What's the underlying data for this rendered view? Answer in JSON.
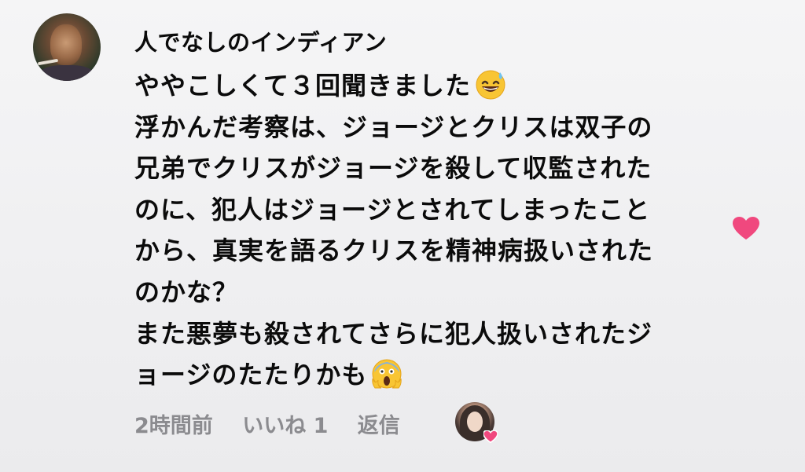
{
  "comment": {
    "username": "人でなしのインディアン",
    "lines": [
      "ややこしくて３回聞きました",
      "浮かんだ考察は、ジョージとクリスは双子の",
      "兄弟でクリスがジョージを殺して収監された",
      "のに、犯人はジョージとされてしまったこと",
      "から、真実を語るクリスを精神病扱いされた",
      "のかな？",
      "また悪夢も殺されてさらに犯人扱いされたジ",
      "ョージのたたりかも"
    ],
    "emoji_line1": "grinning-face-with-sweat",
    "emoji_line8": "face-screaming-in-fear",
    "time": "2時間前",
    "likes": "いいね 1",
    "reply": "返信",
    "like_color": "#f0487e"
  }
}
